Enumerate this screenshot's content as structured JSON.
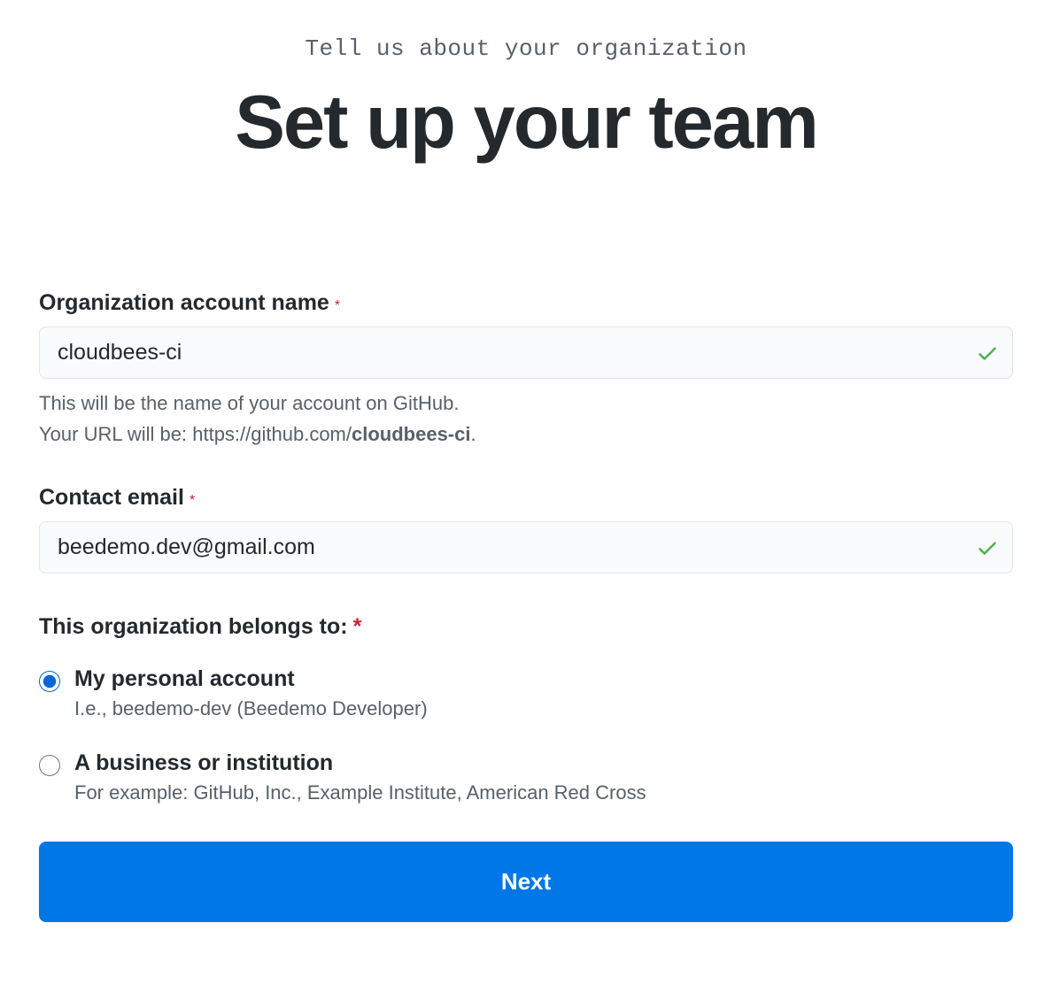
{
  "header": {
    "subtitle": "Tell us about your organization",
    "title": "Set up your team"
  },
  "form": {
    "org_name": {
      "label": "Organization account name",
      "value": "cloudbees-ci",
      "help_line1": "This will be the name of your account on GitHub.",
      "help_line2_prefix": "Your URL will be: https://github.com/",
      "help_line2_bold": "cloudbees-ci",
      "help_line2_suffix": "."
    },
    "email": {
      "label": "Contact email",
      "value": "beedemo.dev@gmail.com"
    },
    "ownership": {
      "label": "This organization belongs to:",
      "options": [
        {
          "title": "My personal account",
          "description": "I.e., beedemo-dev (Beedemo Developer)",
          "selected": true
        },
        {
          "title": "A business or institution",
          "description": "For example: GitHub, Inc., Example Institute, American Red Cross",
          "selected": false
        }
      ]
    },
    "submit_label": "Next",
    "required_mark": "*"
  }
}
